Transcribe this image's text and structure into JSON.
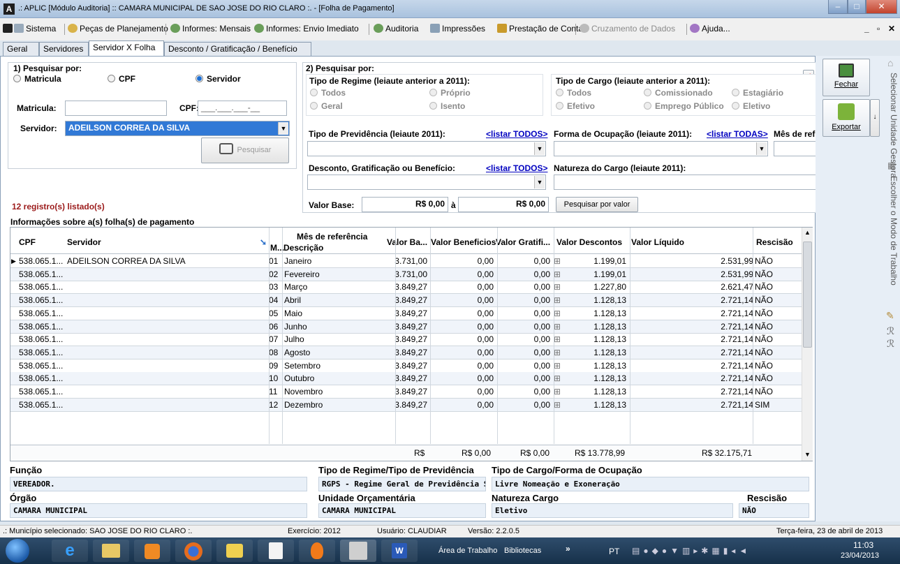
{
  "window": {
    "title": "A .: APLIC [Módulo Auditoria] :: CAMARA MUNICIPAL DE SAO JOSE DO RIO CLARO :. - [Folha de Pagamento]",
    "title_text": ".: APLIC [Módulo Auditoria] :: CAMARA MUNICIPAL DE SAO JOSE DO RIO CLARO :. - [Folha de Pagamento]"
  },
  "menu": [
    "Sistema",
    "Peças de Planejamento",
    "Informes: Mensais",
    "Informes: Envio Imediato",
    "Auditoria",
    "Impressões",
    "Prestação de Contas",
    "Cruzamento de Dados",
    "Ajuda..."
  ],
  "tabs": [
    "Geral",
    "Servidores",
    "Servidor X Folha",
    "Desconto / Gratificação / Benefício"
  ],
  "search1": {
    "title": "1) Pesquisar por:",
    "opt_matricula": "Matricula",
    "opt_cpf": "CPF",
    "opt_servidor": "Servidor",
    "lbl_matricula": "Matricula:",
    "lbl_cpf": "CPF:",
    "cpf_mask": "___.___.___-__",
    "lbl_servidor": "Servidor:",
    "servidor_value": "ADEILSON CORREA DA SILVA",
    "btn_pesquisar": "Pesquisar"
  },
  "search2": {
    "title": "2) Pesquisar por:",
    "regime_title": "Tipo de Regime (leiaute anterior a 2011):",
    "regime_opts": [
      "Todos",
      "Próprio",
      "Geral",
      "Isento"
    ],
    "cargo_title": "Tipo de Cargo (leiaute anterior a 2011):",
    "cargo_opts": [
      "Todos",
      "Comissionado",
      "Estagiário",
      "Efetivo",
      "Emprego Público",
      "Eletivo"
    ],
    "previdencia": "Tipo de Previdência (leiaute 2011):",
    "listar_todos": "<listar TODOS>",
    "ocupacao": "Forma de Ocupação (leiaute 2011):",
    "listar_todas": "<listar TODAS>",
    "mes_ref": "Mês de ref",
    "desconto": "Desconto, Gratificação ou Benefício:",
    "natureza": "Natureza do Cargo (leiaute 2011):",
    "valor_base": "Valor Base:",
    "valor_de": "R$ 0,00",
    "a": "à",
    "valor_ate": "R$ 0,00",
    "btn_valor": "Pesquisar por valor"
  },
  "count": "12 registro(s) listado(s)",
  "grid_title": "Informações sobre a(s) folha(s) de pagamento",
  "columns": {
    "cpf": "CPF",
    "servidor": "Servidor",
    "mes_ref": "Mês de referência",
    "m": "M...",
    "descricao": "Descrição",
    "valor_base": "Valor Ba...",
    "beneficios": "Valor Beneficios",
    "gratif": "Valor Gratifi...",
    "descontos": "Valor Descontos",
    "liquido": "Valor Líquido",
    "rescisao": "Rescisão"
  },
  "rows": [
    {
      "cpf": "538.065.1...",
      "servidor": "ADEILSON CORREA DA SILVA",
      "m": "01",
      "desc": "Janeiro",
      "base": "3.731,00",
      "benef": "0,00",
      "grat": "0,00",
      "desco": "1.199,01",
      "liq": "2.531,99",
      "resc": "NÃO"
    },
    {
      "cpf": "538.065.1...",
      "servidor": "",
      "m": "02",
      "desc": "Fevereiro",
      "base": "3.731,00",
      "benef": "0,00",
      "grat": "0,00",
      "desco": "1.199,01",
      "liq": "2.531,99",
      "resc": "NÃO"
    },
    {
      "cpf": "538.065.1...",
      "servidor": "",
      "m": "03",
      "desc": "Março",
      "base": "3.849,27",
      "benef": "0,00",
      "grat": "0,00",
      "desco": "1.227,80",
      "liq": "2.621,47",
      "resc": "NÃO"
    },
    {
      "cpf": "538.065.1...",
      "servidor": "",
      "m": "04",
      "desc": "Abril",
      "base": "3.849,27",
      "benef": "0,00",
      "grat": "0,00",
      "desco": "1.128,13",
      "liq": "2.721,14",
      "resc": "NÃO"
    },
    {
      "cpf": "538.065.1...",
      "servidor": "",
      "m": "05",
      "desc": "Maio",
      "base": "3.849,27",
      "benef": "0,00",
      "grat": "0,00",
      "desco": "1.128,13",
      "liq": "2.721,14",
      "resc": "NÃO"
    },
    {
      "cpf": "538.065.1...",
      "servidor": "",
      "m": "06",
      "desc": "Junho",
      "base": "3.849,27",
      "benef": "0,00",
      "grat": "0,00",
      "desco": "1.128,13",
      "liq": "2.721,14",
      "resc": "NÃO"
    },
    {
      "cpf": "538.065.1...",
      "servidor": "",
      "m": "07",
      "desc": "Julho",
      "base": "3.849,27",
      "benef": "0,00",
      "grat": "0,00",
      "desco": "1.128,13",
      "liq": "2.721,14",
      "resc": "NÃO"
    },
    {
      "cpf": "538.065.1...",
      "servidor": "",
      "m": "08",
      "desc": "Agosto",
      "base": "3.849,27",
      "benef": "0,00",
      "grat": "0,00",
      "desco": "1.128,13",
      "liq": "2.721,14",
      "resc": "NÃO"
    },
    {
      "cpf": "538.065.1...",
      "servidor": "",
      "m": "09",
      "desc": "Setembro",
      "base": "3.849,27",
      "benef": "0,00",
      "grat": "0,00",
      "desco": "1.128,13",
      "liq": "2.721,14",
      "resc": "NÃO"
    },
    {
      "cpf": "538.065.1...",
      "servidor": "",
      "m": "10",
      "desc": "Outubro",
      "base": "3.849,27",
      "benef": "0,00",
      "grat": "0,00",
      "desco": "1.128,13",
      "liq": "2.721,14",
      "resc": "NÃO"
    },
    {
      "cpf": "538.065.1...",
      "servidor": "",
      "m": "11",
      "desc": "Novembro",
      "base": "3.849,27",
      "benef": "0,00",
      "grat": "0,00",
      "desco": "1.128,13",
      "liq": "2.721,14",
      "resc": "NÃO"
    },
    {
      "cpf": "538.065.1...",
      "servidor": "",
      "m": "12",
      "desc": "Dezembro",
      "base": "3.849,27",
      "benef": "0,00",
      "grat": "0,00",
      "desco": "1.128,13",
      "liq": "2.721,14",
      "resc": "SIM"
    }
  ],
  "totals": {
    "base": "R$",
    "benef": "R$ 0,00",
    "grat": "R$ 0,00",
    "desco": "R$ 13.778,99",
    "liq": "R$ 32.175,71"
  },
  "details": {
    "funcao_lbl": "Função",
    "funcao": "VEREADOR.",
    "regime_lbl": "Tipo de Regime/Tipo de Previdência",
    "regime": "RGPS - Regime Geral de Previdência S",
    "cargo_lbl": "Tipo de Cargo/Forma de Ocupação",
    "cargo": "Livre Nomeação e Exoneração",
    "orgao_lbl": "Órgão",
    "orgao": "CAMARA MUNICIPAL",
    "unidade_lbl": "Unidade Orçamentária",
    "unidade": "CAMARA MUNICIPAL",
    "natureza_lbl": "Natureza Cargo",
    "natureza": "Eletivo",
    "rescisao_lbl": "Rescisão",
    "rescisao": "NÃO"
  },
  "side": {
    "fechar": "Fechar",
    "exportar": "Exportar",
    "vertical1": "Selecionar Unidade Gestora",
    "vertical2": "Escolher o Modo de Trabalho"
  },
  "status": {
    "municipio": ".: Município selecionado: SAO JOSE DO RIO CLARO :.",
    "exercicio": "Exercício: 2012",
    "usuario": "Usuário: CLAUDIAR",
    "versao": "Versão: 2.2.0.5",
    "data": "Terça-feira, 23 de abril de 2013"
  },
  "taskbar": {
    "area": "Área de Trabalho",
    "bibliotecas": "Bibliotecas",
    "lang": "PT",
    "time": "11:03",
    "date": "23/04/2013",
    "chevron": "»"
  }
}
